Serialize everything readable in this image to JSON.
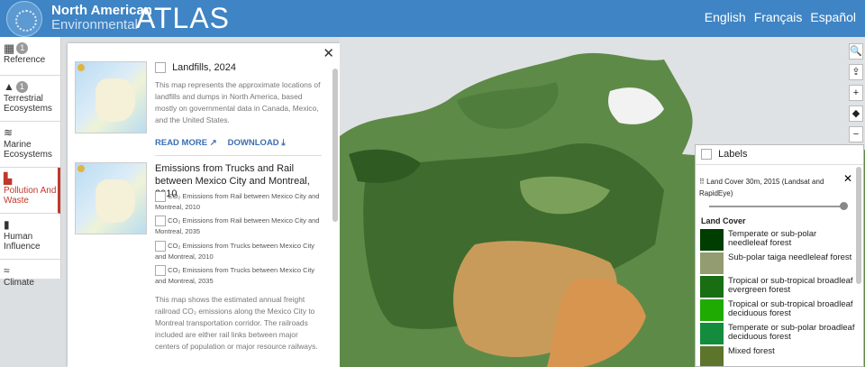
{
  "header": {
    "brand_line1": "North American",
    "brand_line2": "Environmental",
    "brand_atlas": "ATLAS",
    "languages": [
      "English",
      "Français",
      "Español"
    ]
  },
  "nav": [
    {
      "label": "Reference",
      "badge": "1",
      "icon": "grid-icon"
    },
    {
      "label": "Terrestrial Ecosystems",
      "badge": "1",
      "icon": "mountain-icon"
    },
    {
      "label": "Marine Ecosystems",
      "badge": "",
      "icon": "waves-icon"
    },
    {
      "label": "Pollution And Waste",
      "badge": "",
      "icon": "factory-icon",
      "active": true
    },
    {
      "label": "Human Influence",
      "badge": "",
      "icon": "building-icon"
    },
    {
      "label": "Climate",
      "badge": "",
      "icon": "wind-icon"
    }
  ],
  "panel": {
    "close": "✕",
    "layers": [
      {
        "title": "Landfills, 2024",
        "description": "This map represents the approximate locations of landfills and dumps in North America, based mostly on governmental data in Canada, Mexico, and the United States.",
        "read_more": "READ MORE",
        "download": "DOWNLOAD"
      },
      {
        "title": "Emissions from Trucks and Rail between Mexico City and Montreal, 2010",
        "sub_items": [
          "CO₂ Emissions from Rail between Mexico City and Montreal, 2010",
          "CO₂ Emissions from Rail between Mexico City and Montreal, 2035",
          "CO₂ Emissions from Trucks between Mexico City and Montreal, 2010",
          "CO₂ Emissions from Trucks between Mexico City and Montreal, 2035"
        ],
        "description": "This map shows the estimated annual freight railroad CO₂ emissions along the Mexico City to Montreal transportation corridor. The railroads included are either rail links between major centers of population or major resource railways."
      }
    ]
  },
  "tools": [
    "🔍",
    "⇪",
    "+",
    "◆",
    "−"
  ],
  "legend": {
    "labels_toggle": "Labels",
    "layer_name": "Land Cover 30m, 2015 (Landsat and RapidEye)",
    "close": "✕",
    "title": "Land Cover",
    "items": [
      {
        "label": "Temperate or sub-polar needleleaf forest",
        "color": "#003d00"
      },
      {
        "label": "Sub-polar taiga needleleaf forest",
        "color": "#939b71"
      },
      {
        "label": "Tropical or sub-tropical broadleaf evergreen forest",
        "color": "#196d12"
      },
      {
        "label": "Tropical or sub-tropical broadleaf deciduous forest",
        "color": "#1fab01"
      },
      {
        "label": "Temperate or sub-polar broadleaf deciduous forest",
        "color": "#148c3d"
      },
      {
        "label": "Mixed forest",
        "color": "#5c752b"
      }
    ]
  }
}
